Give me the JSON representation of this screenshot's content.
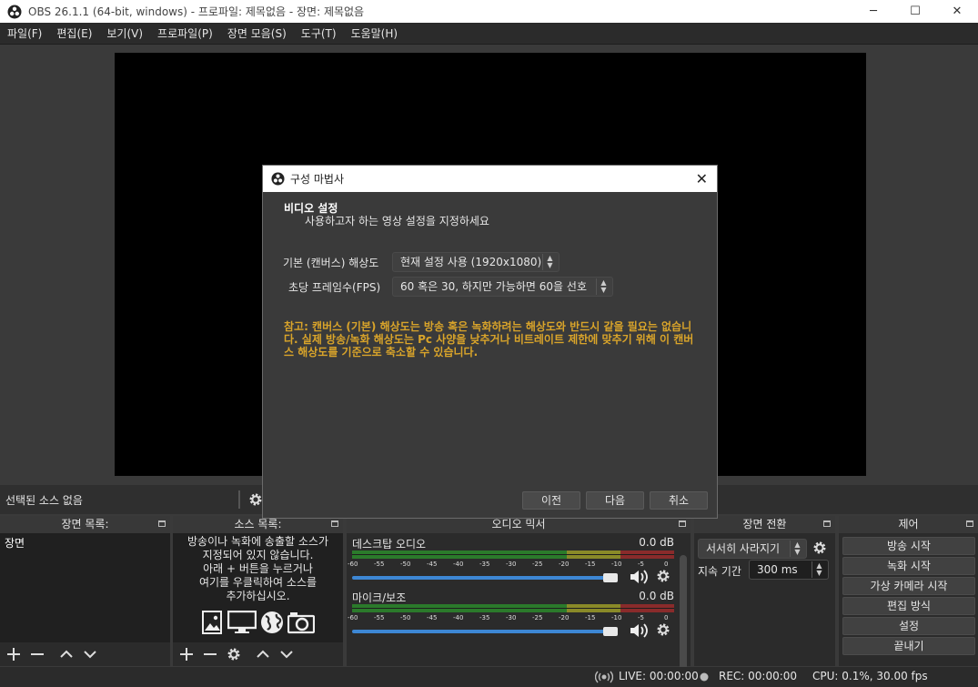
{
  "window": {
    "title": "OBS 26.1.1 (64-bit, windows) - 프로파일: 제목없음 - 장면: 제목없음",
    "minimize": "─",
    "maximize": "☐",
    "close": "✕"
  },
  "menu": {
    "items": [
      "파일(F)",
      "편집(E)",
      "보기(V)",
      "프로파일(P)",
      "장면 모음(S)",
      "도구(T)",
      "도움말(H)"
    ]
  },
  "source_bar": {
    "no_source": "선택된 소스 없음"
  },
  "docks": {
    "scenes": {
      "title": "장면 목록:",
      "items": [
        "장면"
      ]
    },
    "sources": {
      "title": "소스 목록:",
      "hint": [
        "방송이나 녹화에 송출할 소스가",
        "지정되어 있지 않습니다.",
        "아래 + 버튼을 누르거나",
        "여기를 우클릭하여 소스를",
        "추가하십시오."
      ]
    },
    "mixer": {
      "title": "오디오 믹서",
      "scale": [
        "-60",
        "-55",
        "-50",
        "-45",
        "-40",
        "-35",
        "-30",
        "-25",
        "-20",
        "-15",
        "-10",
        "-5",
        "0"
      ],
      "channels": [
        {
          "name": "데스크탑 오디오",
          "db": "0.0 dB",
          "volume": 1.0
        },
        {
          "name": "마이크/보조",
          "db": "0.0 dB",
          "volume": 1.0
        }
      ]
    },
    "transitions": {
      "title": "장면 전환",
      "selected": "서서히 사라지기",
      "duration_label": "지속 기간",
      "duration_value": "300 ms"
    },
    "controls": {
      "title": "제어",
      "buttons": [
        "방송 시작",
        "녹화 시작",
        "가상 카메라 시작",
        "편집 방식",
        "설정",
        "끝내기"
      ]
    }
  },
  "status": {
    "live": "LIVE: 00:00:00",
    "rec": "REC: 00:00:00",
    "cpu": "CPU: 0.1%, 30.00 fps"
  },
  "wizard": {
    "title": "구성 마법사",
    "heading": "비디오 설정",
    "subheading": "사용하고자 하는 영상 설정을 지정하세요",
    "base_res_label": "기본 (캔버스) 해상도",
    "base_res_value": "현재 설정 사용 (1920x1080)",
    "fps_label": "초당 프레임수(FPS)",
    "fps_value": "60 혹은 30, 하지만 가능하면 60을 선호",
    "note": "참고: 캔버스 (기본) 해상도는 방송 혹은 녹화하려는 해상도와 반드시 같을 필요는 없습니다. 실제 방송/녹화 해상도는 Pc 사양을 낮추거나 비트레이트 제한에 맞추기 위해 이 캔버스 해상도를 기준으로 축소할 수 있습니다.",
    "buttons": {
      "back": "이전",
      "next": "다음",
      "cancel": "취소"
    }
  },
  "colors": {
    "accent_blue": "#3d87d4",
    "warning_text": "#d9a42a",
    "meter_green": "#2b7a2b",
    "meter_yellow": "#8a8a28",
    "meter_red": "#8a2b2b"
  }
}
